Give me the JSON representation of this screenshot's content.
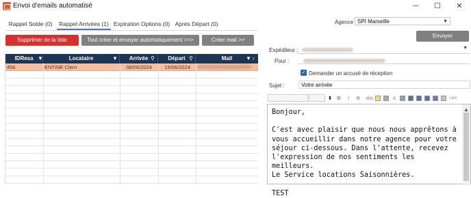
{
  "window": {
    "title": "Envoi d'emails automatisé",
    "icon": "email-app-icon",
    "controls": [
      "─",
      "☐",
      "✕"
    ]
  },
  "tabs": [
    {
      "label": "Rappel Solde (0)",
      "active": false
    },
    {
      "label": "Rappel Arrivées (1)",
      "active": true
    },
    {
      "label": "Expiration Options (0)",
      "active": false
    },
    {
      "label": "Après Départ (0)",
      "active": false
    }
  ],
  "actions": {
    "delete_label": "Supprimer de la liste",
    "auto_label": "Tout créer et envoyer automatiquement >>>",
    "create_label": "Créer mail >>"
  },
  "grid": {
    "columns": [
      "IDResa",
      "Locataire",
      "Arrivée",
      "Départ",
      "Mail"
    ],
    "rows": [
      {
        "id": "456",
        "locataire": "ENTINE Clem",
        "arrivee": "08/06/2024",
        "depart": "15/06/2024",
        "mail": ""
      }
    ],
    "empty_rows": 15,
    "colors": {
      "header": "#1b3556",
      "selected": "#f8bf9f"
    }
  },
  "agency": {
    "label": "Agence",
    "value": "SPI Marseille"
  },
  "send": {
    "label": "Envoyer"
  },
  "form": {
    "sender_label": "Expéditeur :",
    "to_label": "Pour :",
    "receipt_label": "Demander un accusé de réception",
    "receipt_checked": true,
    "subject_label": "Sujet :",
    "subject_value": "Votre arrivée"
  },
  "toolbar": {
    "icons": [
      "bold-icon",
      "italic-icon",
      "underline-icon",
      "strikethrough-icon",
      "highlight-icon",
      "color-icon",
      "align-left-icon",
      "align-center-icon",
      "align-right-icon",
      "justify-icon",
      "image-icon",
      "link-icon"
    ],
    "labels": [
      "B",
      "I",
      "S",
      "abc",
      "",
      "",
      "A",
      "",
      "",
      "",
      "",
      "",
      "Lien"
    ]
  },
  "editor": {
    "body": "Bonjour,\n\nC'est avec plaisir que nous nous apprêtons à vous accueillir dans notre agence pour votre séjour ci-dessous. Dans l'attente, recevez l'expression de nos sentiments les meilleurs.\nLe Service locations Saisonnières.\n\nTEST"
  }
}
